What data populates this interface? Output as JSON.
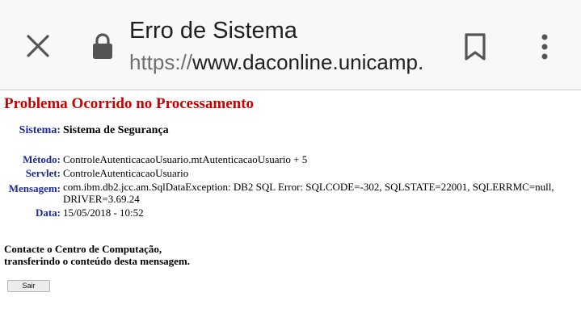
{
  "browser": {
    "page_title": "Erro de Sistema",
    "url_scheme": "https://",
    "url_host": "www.daconline.unicamp.br",
    "icons": {
      "close": "close-icon",
      "lock": "lock-icon",
      "bookmark": "bookmark-icon",
      "menu": "more-vert-icon"
    }
  },
  "page": {
    "title": "Problema Ocorrido no Processamento",
    "sistema": {
      "label": "Sistema:",
      "value": "Sistema de Segurança"
    },
    "details": [
      {
        "label": "Método:",
        "value": "ControleAutenticacaoUsuario.mtAutenticacaoUsuario + 5"
      },
      {
        "label": "Servlet:",
        "value": "ControleAutenticacaoUsuario"
      },
      {
        "label": "Mensagem:",
        "value": "com.ibm.db2.jcc.am.SqlDataException: DB2 SQL Error: SQLCODE=-302, SQLSTATE=22001, SQLERRMC=null, DRIVER=3.69.24"
      },
      {
        "label": "Data:",
        "value": "15/05/2018 - 10:52"
      }
    ],
    "contact_line1": "Contacte o Centro de Computação,",
    "contact_line2": "transferindo o conteúdo desta mensagem.",
    "sair_label": "Sair"
  },
  "colors": {
    "title_red": "#cc0000",
    "label_blue": "#1a2a9a",
    "toolbar_bg": "#f8f8f8"
  }
}
